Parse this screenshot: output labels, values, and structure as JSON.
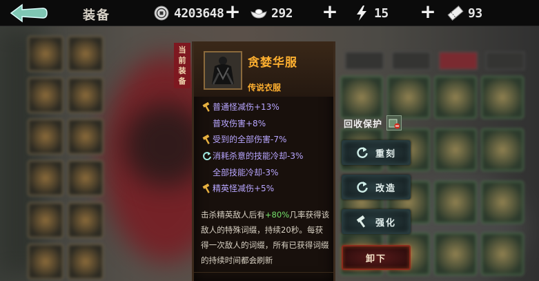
{
  "header": {
    "title": "装备",
    "resources": [
      {
        "name": "coin",
        "icon": "coin-icon",
        "value": "4203648"
      },
      {
        "name": "ingot",
        "icon": "ingot-icon",
        "value": "292"
      },
      {
        "name": "energy",
        "icon": "lightning-icon",
        "value": "15"
      },
      {
        "name": "ticket",
        "icon": "ticket-icon",
        "value": "93"
      }
    ]
  },
  "current_equip_label": "当前装备",
  "item": {
    "name": "贪婪华服",
    "type": "传说衣服",
    "stats": [
      {
        "icon": "hammer-icon",
        "text": "普通怪减伤+13%"
      },
      {
        "icon": "none",
        "text": "普攻伤害+8%"
      },
      {
        "icon": "hammer-icon",
        "text": "受到的全部伤害-7%"
      },
      {
        "icon": "refresh-icon",
        "text": "消耗杀意的技能冷却-3%"
      },
      {
        "icon": "none",
        "text": "全部技能冷却-3%"
      },
      {
        "icon": "hammer-icon",
        "text": "精英怪减伤+5%"
      }
    ],
    "description": {
      "part1": "击杀精英敌人后有",
      "highlight": "+80%",
      "part2": "几率获得该敌人的特殊词缀，持续20秒。每获得一次敌人的词缀，所有已获得词缀的持续时间都会刷新"
    }
  },
  "actions": {
    "protect_label": "回收保护",
    "reforge_label": "重刻",
    "modify_label": "改造",
    "enhance_label": "强化",
    "unequip_label": "卸下"
  },
  "colors": {
    "item_name": "#ffb030",
    "stat_text": "#b8a6ff",
    "highlight": "#74e06a",
    "current_label_bg": "#7e1820"
  }
}
